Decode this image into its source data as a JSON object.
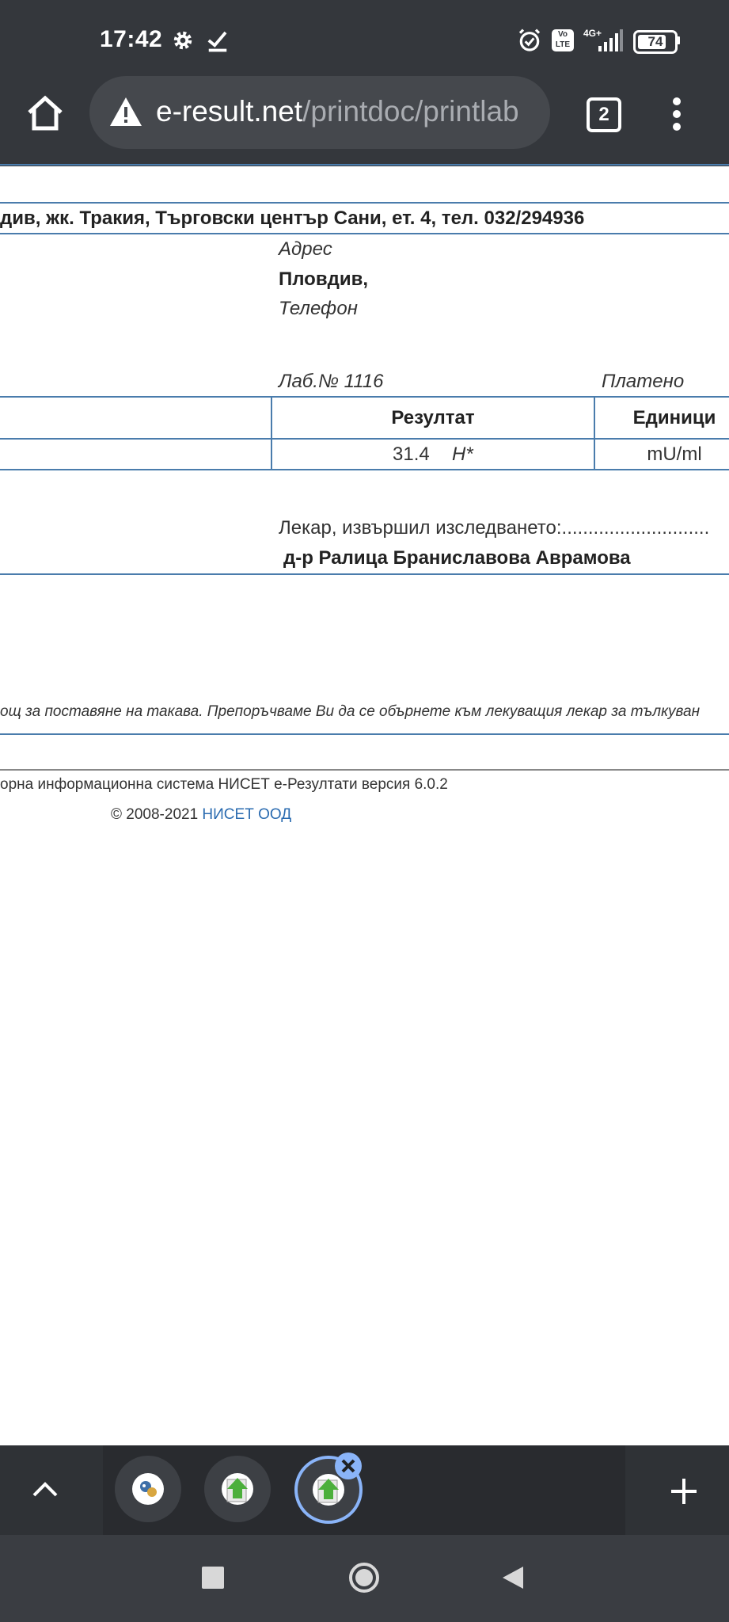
{
  "status_bar": {
    "time": "17:42",
    "icons": [
      "gear-icon",
      "check-icon",
      "alarm-icon",
      "volte-icon",
      "signal-4g-icon"
    ],
    "network": "4G+",
    "volte": "Vo LTE",
    "battery": "74"
  },
  "browser": {
    "url_domain": "e-result.net",
    "url_path": "/printdoc/printlab",
    "tab_count": "2"
  },
  "document": {
    "address_line": "див, жк. Тракия, Търговски център Сани, ет. 4, тел. 032/294936",
    "address_label": "Адрес",
    "city": "Пловдив,",
    "phone_label": "Телефон",
    "lab_no": "Лаб.№ 1116",
    "paid": "Платено",
    "table": {
      "headers": [
        "Резултат",
        "Единици"
      ],
      "rows": [
        {
          "result": "31.4",
          "flag": "H*",
          "units": "mU/ml"
        }
      ]
    },
    "doctor_label": "Лекар, извършил изследването:............................",
    "doctor_name": "д-р Ралица Браниславова Аврамова",
    "disclaimer": "ощ за поставяне на такава. Препоръчваме Ви да се обърнете към лекуващия лекар за тълкуван",
    "footer_system": "орна информационна система НИСЕТ е-Резултати версия 6.0.2",
    "footer_copyright": "© 2008-2021",
    "footer_company": "НИСЕТ ООД"
  },
  "colors": {
    "chrome_dark": "#34373c",
    "table_border": "#4a7cac",
    "link": "#2a6bb0",
    "tab_active_ring": "#8ab4f8"
  }
}
